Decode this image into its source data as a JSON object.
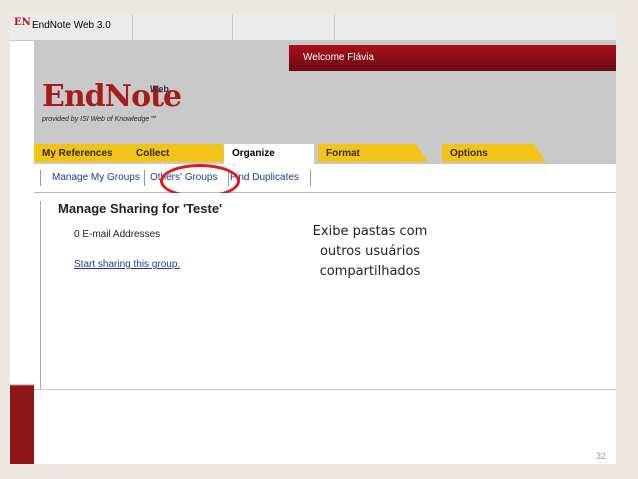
{
  "window": {
    "title": "EndNote Web 3.0",
    "logo_glyph": "EN"
  },
  "header": {
    "welcome": "Welcome Flávia",
    "brand_name": "EndNote",
    "brand_suffix": "Web",
    "brand_byline": "provided by ISI Web of Knowledge℠"
  },
  "tabs": [
    {
      "label": "My References"
    },
    {
      "label": "Collect"
    },
    {
      "label": "Organize",
      "active": true
    },
    {
      "label": "Format"
    },
    {
      "label": "Options"
    }
  ],
  "subtabs": [
    {
      "label": "Manage My Groups"
    },
    {
      "label": "Others' Groups",
      "highlighted": true
    },
    {
      "label": "Find Duplicates"
    }
  ],
  "main": {
    "heading": "Manage Sharing for 'Teste'",
    "emails": "0 E-mail Addresses",
    "start_link": "Start sharing this group."
  },
  "callout": {
    "lines": [
      "Exibe pastas com",
      "outros usuários",
      "compartilhados"
    ]
  },
  "slide": {
    "page_number": "32"
  },
  "colors": {
    "accent_red": "#a51c1c",
    "tab_yellow": "#f2c41a",
    "highlight_red": "#e01818",
    "link_blue": "#1f3a93"
  }
}
